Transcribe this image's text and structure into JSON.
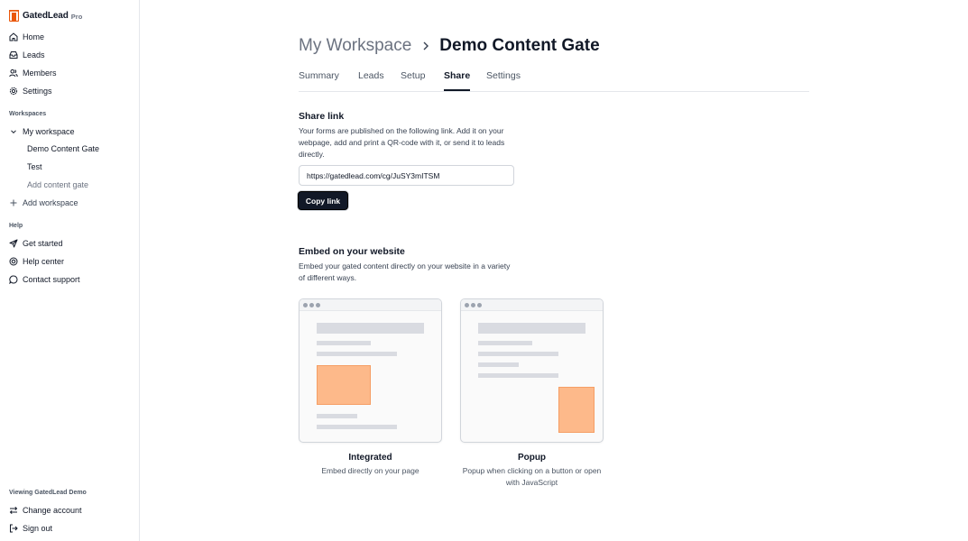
{
  "brand": {
    "name": "GatedLead",
    "plan": "Pro",
    "accent": "#ea580c"
  },
  "sidebar": {
    "main_items": [
      {
        "label": "Home",
        "icon": "home-icon"
      },
      {
        "label": "Leads",
        "icon": "inbox-icon"
      },
      {
        "label": "Members",
        "icon": "users-icon"
      },
      {
        "label": "Settings",
        "icon": "gear-icon"
      }
    ],
    "workspaces_title": "Workspaces",
    "workspace": {
      "label": "My workspace",
      "icon": "chevron-down-icon"
    },
    "workspace_items": [
      "Demo Content Gate",
      "Test"
    ],
    "add_content_gate": "Add content gate",
    "add_workspace": {
      "label": "Add workspace",
      "icon": "plus-icon"
    },
    "help_title": "Help",
    "help_items": [
      {
        "label": "Get started",
        "icon": "send-icon"
      },
      {
        "label": "Help center",
        "icon": "lifebuoy-icon"
      },
      {
        "label": "Contact support",
        "icon": "chat-icon"
      }
    ],
    "viewing_label": "Viewing GatedLead Demo",
    "change_account": {
      "label": "Change account",
      "icon": "swap-icon"
    },
    "sign_out": {
      "label": "Sign out",
      "icon": "sign-out-icon"
    }
  },
  "breadcrumb": {
    "parent": "My Workspace",
    "current": "Demo Content Gate"
  },
  "tabs": [
    {
      "label": "Summary",
      "active": false
    },
    {
      "label": "Leads",
      "active": false
    },
    {
      "label": "Setup",
      "active": false
    },
    {
      "label": "Share",
      "active": true
    },
    {
      "label": "Settings",
      "active": false
    }
  ],
  "share": {
    "title": "Share link",
    "description": "Your forms are published on the following link. Add it on your webpage, add and print a QR-code with it, or send it to leads directly.",
    "url": "https://gatedlead.com/cg/JuSY3mITSM",
    "copy_label": "Copy link"
  },
  "embed": {
    "title": "Embed on your website",
    "description": "Embed your gated content directly on your website in a variety of different ways.",
    "options": [
      {
        "title": "Integrated",
        "description": "Embed directly on your page"
      },
      {
        "title": "Popup",
        "description": "Popup when clicking on a button or open with JavaScript"
      }
    ]
  }
}
